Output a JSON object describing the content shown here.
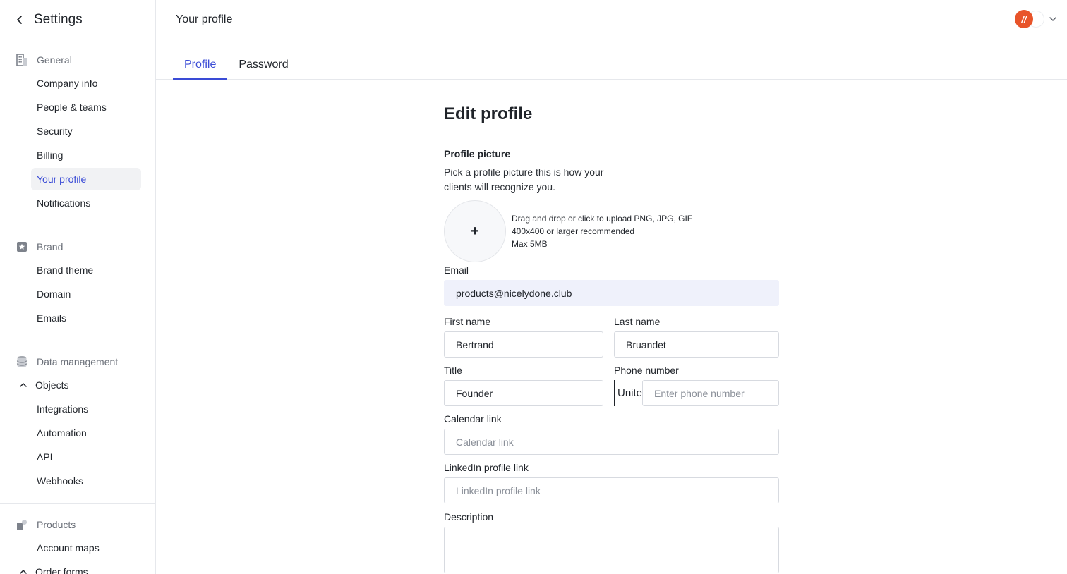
{
  "sidebar": {
    "title": "Settings",
    "sections": {
      "general": {
        "label": "General",
        "items": [
          "Company info",
          "People & teams",
          "Security",
          "Billing",
          "Your profile",
          "Notifications"
        ]
      },
      "brand": {
        "label": "Brand",
        "items": [
          "Brand theme",
          "Domain",
          "Emails"
        ]
      },
      "data": {
        "label": "Data management",
        "group": "Objects",
        "items": [
          "Integrations",
          "Automation",
          "API",
          "Webhooks"
        ]
      },
      "products": {
        "label": "Products",
        "items": [
          "Account maps"
        ],
        "group": "Order forms"
      }
    },
    "active_item": "Your profile"
  },
  "topbar": {
    "title": "Your profile",
    "avatar_initial": "//"
  },
  "tabs": [
    "Profile",
    "Password"
  ],
  "active_tab": "Profile",
  "form": {
    "title": "Edit profile",
    "profile_picture_label": "Profile picture",
    "profile_picture_help": "Pick a profile picture this is how your clients will recognize you.",
    "upload_plus": "+",
    "upload_lines": [
      "Drag and drop or click to upload PNG, JPG, GIF",
      "400x400 or larger recommended",
      "Max 5MB"
    ],
    "email": {
      "label": "Email",
      "value": "products@nicelydone.club"
    },
    "first_name": {
      "label": "First name",
      "value": "Bertrand"
    },
    "last_name": {
      "label": "Last name",
      "value": "Bruandet"
    },
    "title_field": {
      "label": "Title",
      "value": "Founder"
    },
    "phone": {
      "label": "Phone number",
      "country": "Unite",
      "placeholder": "Enter phone number"
    },
    "calendar": {
      "label": "Calendar link",
      "placeholder": "Calendar link"
    },
    "linkedin": {
      "label": "LinkedIn profile link",
      "placeholder": "LinkedIn profile link"
    },
    "description": {
      "label": "Description",
      "placeholder": ""
    }
  },
  "colors": {
    "accent": "#3a4bd6",
    "avatar": "#e8542a",
    "readonly_bg": "#eff1fb"
  }
}
